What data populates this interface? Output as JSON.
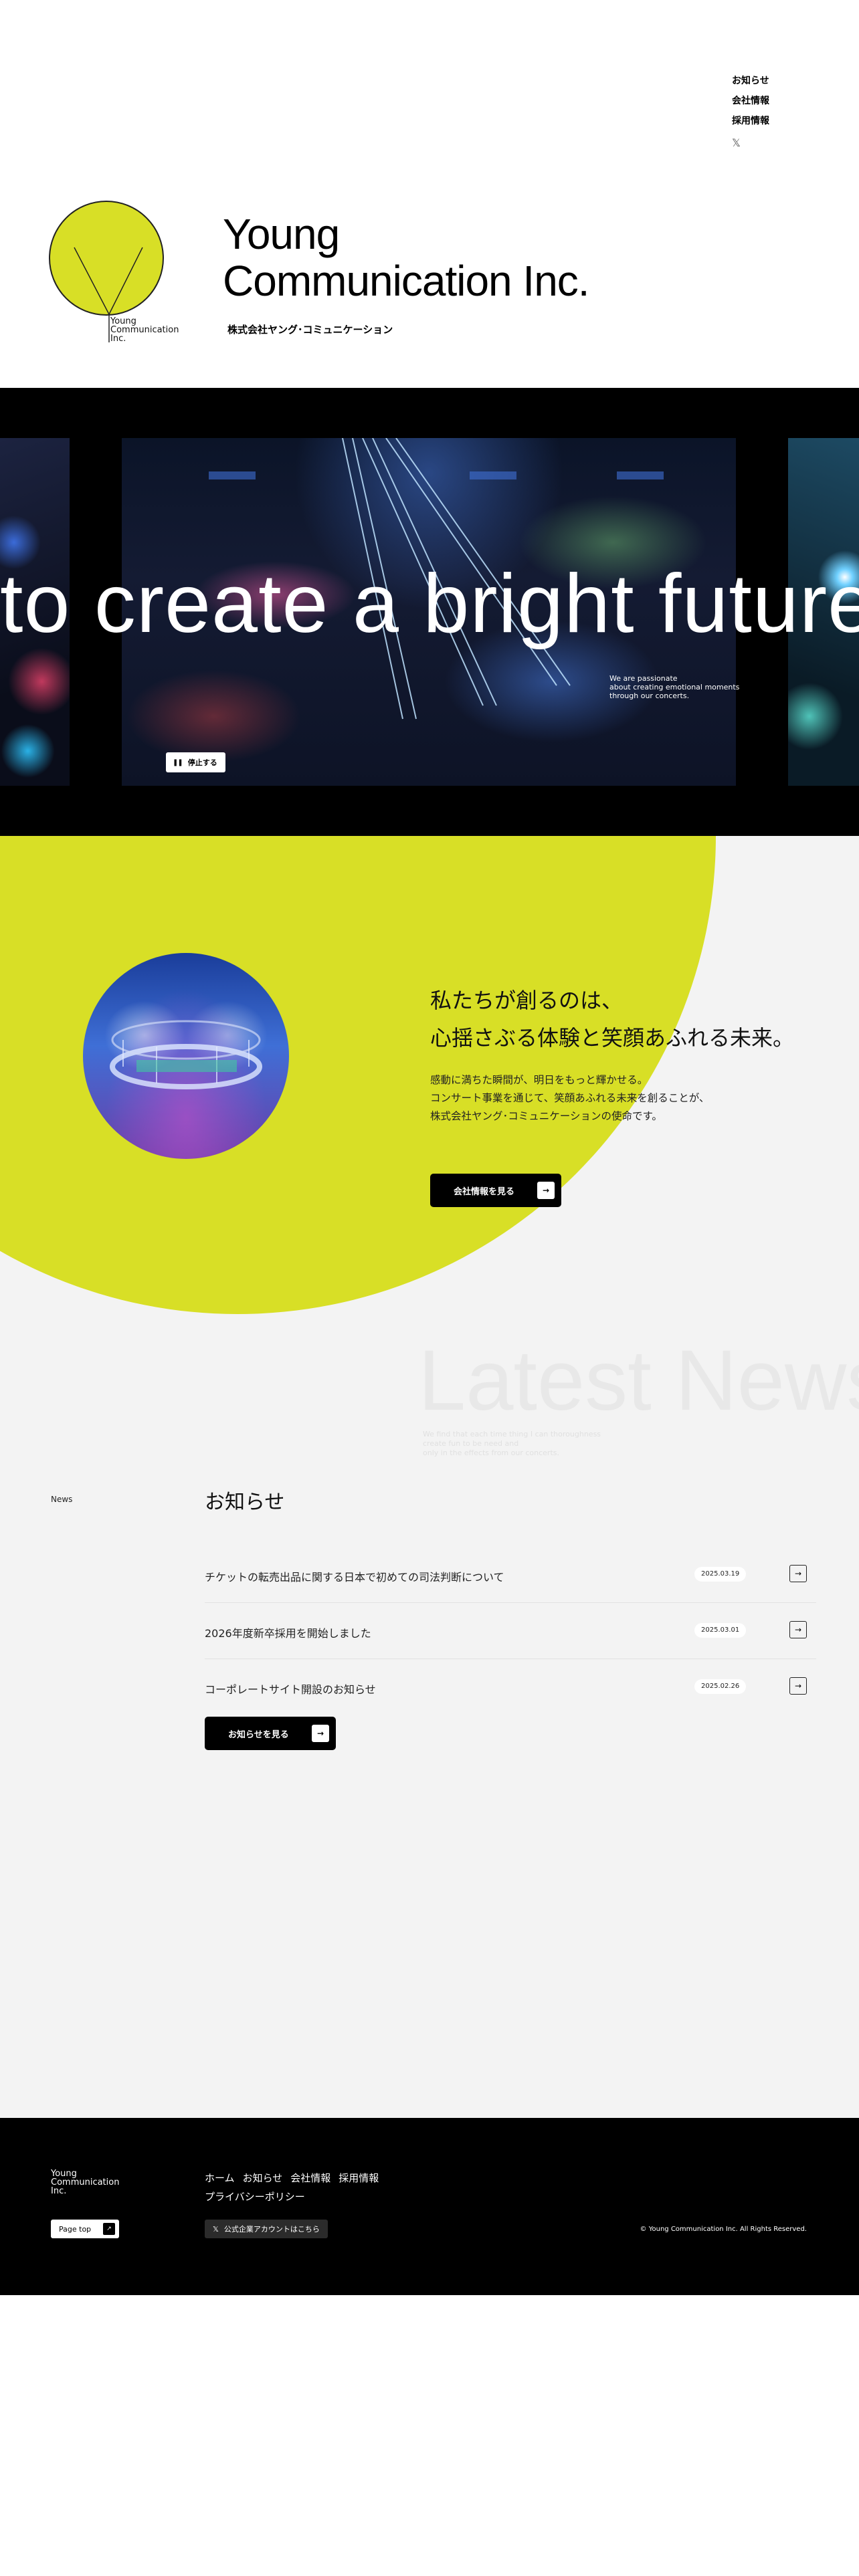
{
  "colors": {
    "accent": "#d8df26",
    "background": "#f3f3f3",
    "dark": "#000000"
  },
  "header": {
    "logo_mark_text": "Young\nCommunication\nInc.",
    "brand_title": "Young\nCommunication Inc.",
    "brand_subtitle": "株式会社ヤング･コミュニケーション",
    "nav": {
      "news": "お知らせ",
      "company": "会社情報",
      "recruit": "採用情報",
      "x_icon": "x-logo-icon"
    }
  },
  "hero": {
    "marquee": "to create a bright future",
    "caption": "We are passionate\nabout creating emotional moments\nthrough our concerts.",
    "pause_label": "停止する",
    "pause_icon": "pause-icon"
  },
  "about": {
    "title": "私たちが創るのは、\n心揺さぶる体験と笑顔あふれる未来。",
    "body": "感動に満ちた瞬間が、明日をもっと輝かせる。\nコンサート事業を通じて、笑顔あふれる未来を創ることが、\n株式会社ヤング･コミュニケーションの使命です。",
    "button_label": "会社情報を見る",
    "ghost_title": "Latest News",
    "ghost_subtitle": "We find that each time thing I can thoroughness\ncreate fun to be need and\nonly in the effects from our concerts."
  },
  "news": {
    "label": "News",
    "heading": "お知らせ",
    "items": [
      {
        "title": "チケットの転売出品に関する日本で初めての司法判断について",
        "date": "2025.03.19"
      },
      {
        "title": "2026年度新卒採用を開始しました",
        "date": "2025.03.01"
      },
      {
        "title": "コーポレートサイト開設のお知らせ",
        "date": "2025.02.26"
      }
    ],
    "button_label": "お知らせを見る"
  },
  "footer": {
    "logo_text": "Young\nCommunication\nInc.",
    "nav": {
      "home": "ホーム",
      "news": "お知らせ",
      "company": "会社情報",
      "recruit": "採用情報",
      "privacy": "プライバシーポリシー"
    },
    "pagetop_label": "Page top",
    "x_account_label": "公式企業アカウントはこちら",
    "copyright": "© Young Communication Inc. All Rights Reserved."
  }
}
